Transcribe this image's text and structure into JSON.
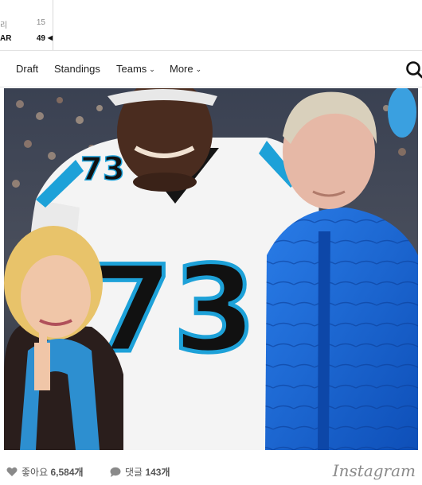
{
  "scoreboard": {
    "row1": {
      "team": "리",
      "score": "15"
    },
    "row2": {
      "team": "AR",
      "score": "49",
      "caret": "◀"
    }
  },
  "nav": {
    "items": [
      {
        "label": ""
      },
      {
        "label": "Draft"
      },
      {
        "label": "Standings"
      },
      {
        "label": "Teams",
        "chevron": "⌄"
      },
      {
        "label": "More",
        "chevron": "⌄"
      }
    ],
    "search_icon": "search-icon"
  },
  "photo": {
    "jersey_number": "73",
    "jersey_color": "#f4f4f4",
    "jersey_trim": "#1da1d8",
    "jacket_color": "#1565d8"
  },
  "instagram": {
    "likes_label": "좋아요",
    "likes_count": "6,584개",
    "comments_label": "댓글",
    "comments_count": "143개",
    "wordmark": "Instagram",
    "heart_icon": "heart-icon",
    "comment_icon": "comment-bubble-icon"
  }
}
